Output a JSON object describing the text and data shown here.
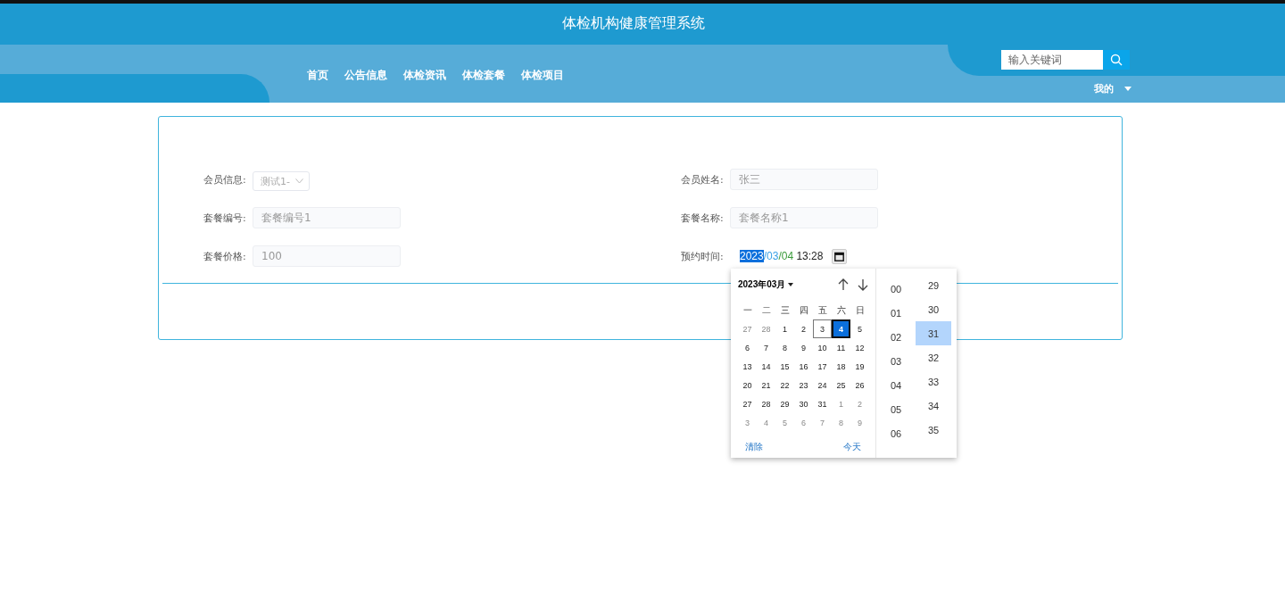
{
  "header": {
    "title": "体检机构健康管理系统"
  },
  "nav": [
    {
      "label": "首页"
    },
    {
      "label": "公告信息"
    },
    {
      "label": "体检资讯"
    },
    {
      "label": "体检套餐"
    },
    {
      "label": "体检项目"
    }
  ],
  "search": {
    "placeholder": "输入关键词"
  },
  "user_menu": {
    "label": "我的"
  },
  "form": {
    "fields": [
      {
        "label": "会员信息:",
        "kind": "select",
        "value": "测试1-"
      },
      {
        "label": "会员姓名:",
        "kind": "input",
        "value": "张三"
      },
      {
        "label": "套餐编号:",
        "kind": "input",
        "value": "套餐编号1"
      },
      {
        "label": "套餐名称:",
        "kind": "input",
        "value": "套餐名称1"
      },
      {
        "label": "套餐价格:",
        "kind": "input",
        "value": "100"
      },
      {
        "label": "预约时间:",
        "kind": "datetime",
        "segments": [
          {
            "text": "2023",
            "selected": true
          },
          {
            "text": "/03",
            "selected": false,
            "color": "#3aa0e6"
          },
          {
            "text": "/04",
            "selected": false,
            "color": "#3a9a3a"
          },
          {
            "text": " 13:28",
            "selected": false,
            "color": "#222222"
          }
        ]
      }
    ]
  },
  "date_picker": {
    "month_label": "2023年03月",
    "weekdays": [
      "一",
      "二",
      "三",
      "四",
      "五",
      "六",
      "日"
    ],
    "days": [
      {
        "label": "27",
        "other_month": true,
        "today": false,
        "selected": false
      },
      {
        "label": "28",
        "other_month": true,
        "today": false,
        "selected": false
      },
      {
        "label": "1",
        "other_month": false,
        "today": false,
        "selected": false
      },
      {
        "label": "2",
        "other_month": false,
        "today": false,
        "selected": false
      },
      {
        "label": "3",
        "other_month": false,
        "today": true,
        "selected": false
      },
      {
        "label": "4",
        "other_month": false,
        "today": false,
        "selected": true
      },
      {
        "label": "5",
        "other_month": false,
        "today": false,
        "selected": false
      },
      {
        "label": "6",
        "other_month": false,
        "today": false,
        "selected": false
      },
      {
        "label": "7",
        "other_month": false,
        "today": false,
        "selected": false
      },
      {
        "label": "8",
        "other_month": false,
        "today": false,
        "selected": false
      },
      {
        "label": "9",
        "other_month": false,
        "today": false,
        "selected": false
      },
      {
        "label": "10",
        "other_month": false,
        "today": false,
        "selected": false
      },
      {
        "label": "11",
        "other_month": false,
        "today": false,
        "selected": false
      },
      {
        "label": "12",
        "other_month": false,
        "today": false,
        "selected": false
      },
      {
        "label": "13",
        "other_month": false,
        "today": false,
        "selected": false
      },
      {
        "label": "14",
        "other_month": false,
        "today": false,
        "selected": false
      },
      {
        "label": "15",
        "other_month": false,
        "today": false,
        "selected": false
      },
      {
        "label": "16",
        "other_month": false,
        "today": false,
        "selected": false
      },
      {
        "label": "17",
        "other_month": false,
        "today": false,
        "selected": false
      },
      {
        "label": "18",
        "other_month": false,
        "today": false,
        "selected": false
      },
      {
        "label": "19",
        "other_month": false,
        "today": false,
        "selected": false
      },
      {
        "label": "20",
        "other_month": false,
        "today": false,
        "selected": false
      },
      {
        "label": "21",
        "other_month": false,
        "today": false,
        "selected": false
      },
      {
        "label": "22",
        "other_month": false,
        "today": false,
        "selected": false
      },
      {
        "label": "23",
        "other_month": false,
        "today": false,
        "selected": false
      },
      {
        "label": "24",
        "other_month": false,
        "today": false,
        "selected": false
      },
      {
        "label": "25",
        "other_month": false,
        "today": false,
        "selected": false
      },
      {
        "label": "26",
        "other_month": false,
        "today": false,
        "selected": false
      },
      {
        "label": "27",
        "other_month": false,
        "today": false,
        "selected": false
      },
      {
        "label": "28",
        "other_month": false,
        "today": false,
        "selected": false
      },
      {
        "label": "29",
        "other_month": false,
        "today": false,
        "selected": false
      },
      {
        "label": "30",
        "other_month": false,
        "today": false,
        "selected": false
      },
      {
        "label": "31",
        "other_month": false,
        "today": false,
        "selected": false
      },
      {
        "label": "1",
        "other_month": true,
        "today": false,
        "selected": false
      },
      {
        "label": "2",
        "other_month": true,
        "today": false,
        "selected": false
      },
      {
        "label": "3",
        "other_month": true,
        "today": false,
        "selected": false
      },
      {
        "label": "4",
        "other_month": true,
        "today": false,
        "selected": false
      },
      {
        "label": "5",
        "other_month": true,
        "today": false,
        "selected": false
      },
      {
        "label": "6",
        "other_month": true,
        "today": false,
        "selected": false
      },
      {
        "label": "7",
        "other_month": true,
        "today": false,
        "selected": false
      },
      {
        "label": "8",
        "other_month": true,
        "today": false,
        "selected": false
      },
      {
        "label": "9",
        "other_month": true,
        "today": false,
        "selected": false
      }
    ],
    "clear_label": "清除",
    "today_label": "今天",
    "hours": [
      {
        "label": "00",
        "selected": false
      },
      {
        "label": "01",
        "selected": false
      },
      {
        "label": "02",
        "selected": false
      },
      {
        "label": "03",
        "selected": false
      },
      {
        "label": "04",
        "selected": false
      },
      {
        "label": "05",
        "selected": false
      },
      {
        "label": "06",
        "selected": false
      }
    ],
    "minutes": [
      {
        "label": "29",
        "selected": false
      },
      {
        "label": "30",
        "selected": false
      },
      {
        "label": "31",
        "selected": true
      },
      {
        "label": "32",
        "selected": false
      },
      {
        "label": "33",
        "selected": false
      },
      {
        "label": "34",
        "selected": false
      },
      {
        "label": "35",
        "selected": false
      }
    ]
  }
}
